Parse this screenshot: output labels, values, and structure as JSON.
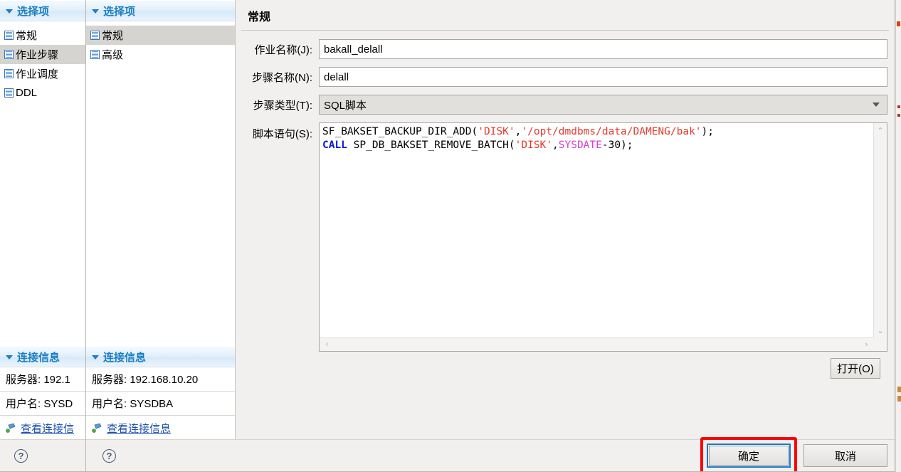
{
  "back_dialog": {
    "options": {
      "header": "选择项",
      "items": [
        {
          "label": "常规",
          "selected": false
        },
        {
          "label": "作业步骤",
          "selected": true
        },
        {
          "label": "作业调度",
          "selected": false
        },
        {
          "label": "DDL",
          "selected": false
        }
      ]
    },
    "connection": {
      "header": "连接信息",
      "server": "服务器: 192.1",
      "user": "用户名: SYSD",
      "link": "查看连接信"
    }
  },
  "front_dialog": {
    "options": {
      "header": "选择项",
      "items": [
        {
          "label": "常规",
          "selected": true
        },
        {
          "label": "高级",
          "selected": false
        }
      ]
    },
    "connection": {
      "header": "连接信息",
      "server": "服务器: 192.168.10.20",
      "user": "用户名: SYSDBA",
      "link": "查看连接信息"
    },
    "content": {
      "title": "常规",
      "fields": {
        "job_name": {
          "label": "作业名称(J):",
          "value": "bakall_delall"
        },
        "step_name": {
          "label": "步骤名称(N):",
          "value": "delall"
        },
        "step_type": {
          "label": "步骤类型(T):",
          "value": "SQL脚本"
        },
        "script": {
          "label": "脚本语句(S):"
        }
      },
      "script_lines": [
        [
          {
            "t": "SF_BAKSET_BACKUP_DIR_ADD(",
            "c": "plain"
          },
          {
            "t": "'DISK'",
            "c": "str"
          },
          {
            "t": ",",
            "c": "plain"
          },
          {
            "t": "'/opt/dmdbms/data/DAMENG/bak'",
            "c": "str"
          },
          {
            "t": ");",
            "c": "plain"
          }
        ],
        [
          {
            "t": "CALL",
            "c": "kw"
          },
          {
            "t": " SP_DB_BAKSET_REMOVE_BATCH(",
            "c": "plain"
          },
          {
            "t": "'DISK'",
            "c": "str"
          },
          {
            "t": ",",
            "c": "plain"
          },
          {
            "t": "SYSDATE",
            "c": "fn"
          },
          {
            "t": "-30);",
            "c": "plain"
          }
        ]
      ],
      "open_button": "打开(O)"
    },
    "footer": {
      "ok": "确定",
      "cancel": "取消"
    }
  },
  "icons": {
    "help": "?",
    "scroll_up": "⌃",
    "scroll_down": "⌄",
    "scroll_left": "‹",
    "scroll_right": "›"
  },
  "colors": {
    "accent_blue": "#1a7ec4",
    "link_blue": "#1a4fad",
    "annotation_red": "#fe0000",
    "focus_blue": "#1a7ac8",
    "string_red": "#e8392e",
    "keyword_blue": "#0a18d6",
    "function_magenta": "#d63fd6"
  }
}
